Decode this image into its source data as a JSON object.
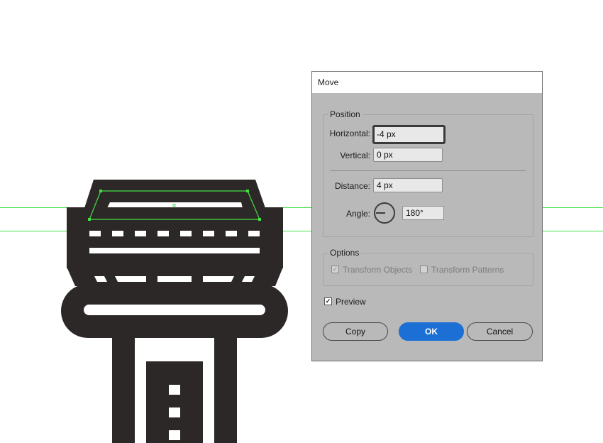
{
  "colors": {
    "illustration": "#2d2828",
    "guide": "#44e044",
    "dialog_bg": "#b9b9b9",
    "accent": "#1c6fd4"
  },
  "dialog": {
    "title": "Move",
    "position": {
      "legend": "Position",
      "horizontal_label": "Horizontal:",
      "horizontal_value": "-4 px",
      "vertical_label": "Vertical:",
      "vertical_value": "0 px",
      "distance_label": "Distance:",
      "distance_value": "4 px",
      "angle_label": "Angle:",
      "angle_value": "180°"
    },
    "options": {
      "legend": "Options",
      "transform_objects": {
        "label": "Transform Objects",
        "checked": true,
        "disabled": true
      },
      "transform_patterns": {
        "label": "Transform Patterns",
        "checked": false,
        "disabled": true
      }
    },
    "preview": {
      "label": "Preview",
      "checked": true
    },
    "buttons": {
      "copy": "Copy",
      "ok": "OK",
      "cancel": "Cancel"
    }
  }
}
